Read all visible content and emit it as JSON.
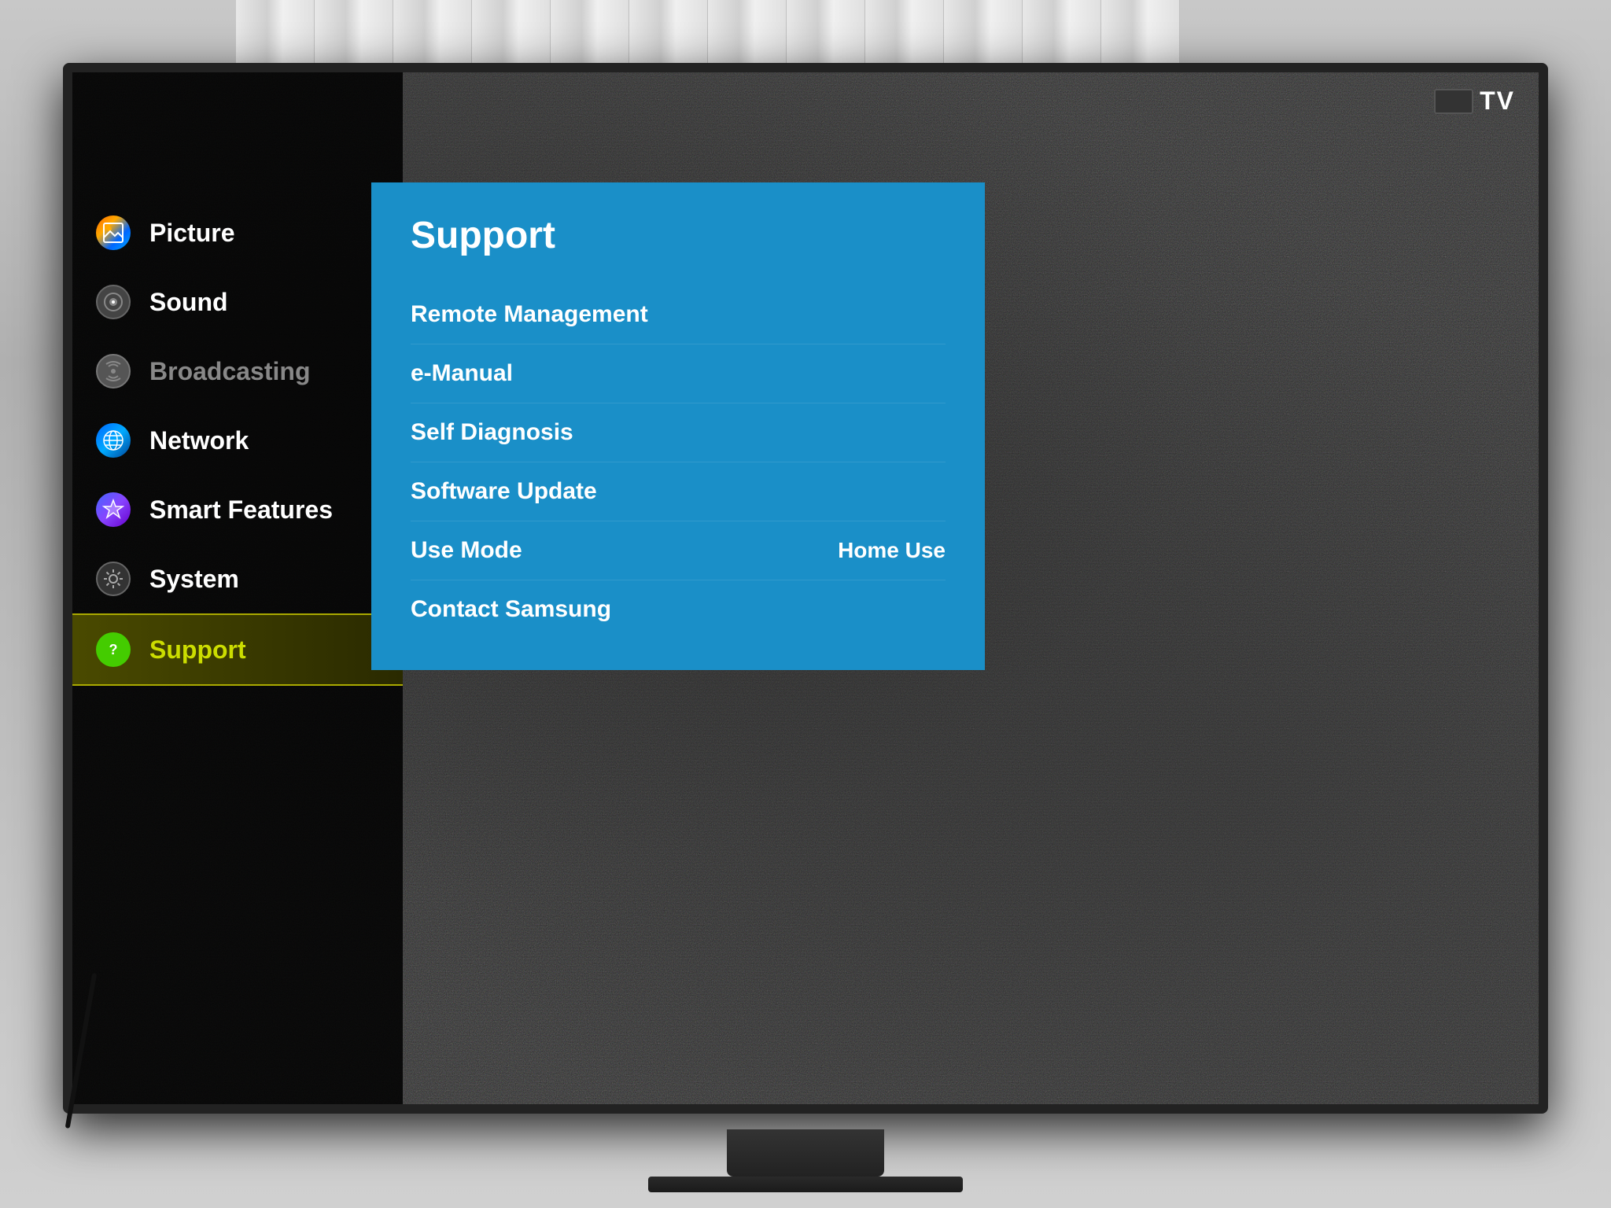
{
  "room": {
    "bg_color": "#c0c0c0"
  },
  "tv": {
    "logo": "TV",
    "source_indicator": "TV"
  },
  "sidebar": {
    "items": [
      {
        "id": "picture",
        "label": "Picture",
        "icon": "🖼",
        "icon_type": "picture",
        "active": false,
        "dimmed": false
      },
      {
        "id": "sound",
        "label": "Sound",
        "icon": "🔊",
        "icon_type": "sound",
        "active": false,
        "dimmed": false
      },
      {
        "id": "broadcasting",
        "label": "Broadcasting",
        "icon": "📡",
        "icon_type": "broadcasting",
        "active": false,
        "dimmed": true
      },
      {
        "id": "network",
        "label": "Network",
        "icon": "🌐",
        "icon_type": "network",
        "active": false,
        "dimmed": false
      },
      {
        "id": "smart-features",
        "label": "Smart Features",
        "icon": "⬡",
        "icon_type": "smart",
        "active": false,
        "dimmed": false
      },
      {
        "id": "system",
        "label": "System",
        "icon": "⚙",
        "icon_type": "system",
        "active": false,
        "dimmed": false
      },
      {
        "id": "support",
        "label": "Support",
        "icon": "?",
        "icon_type": "support",
        "active": true,
        "dimmed": false
      }
    ]
  },
  "content": {
    "title": "Support",
    "menu_items": [
      {
        "id": "remote-management",
        "label": "Remote Management",
        "value": ""
      },
      {
        "id": "e-manual",
        "label": "e-Manual",
        "value": ""
      },
      {
        "id": "self-diagnosis",
        "label": "Self Diagnosis",
        "value": ""
      },
      {
        "id": "software-update",
        "label": "Software Update",
        "value": ""
      },
      {
        "id": "use-mode",
        "label": "Use Mode",
        "value": "Home Use"
      },
      {
        "id": "contact-samsung",
        "label": "Contact Samsung",
        "value": ""
      }
    ]
  }
}
